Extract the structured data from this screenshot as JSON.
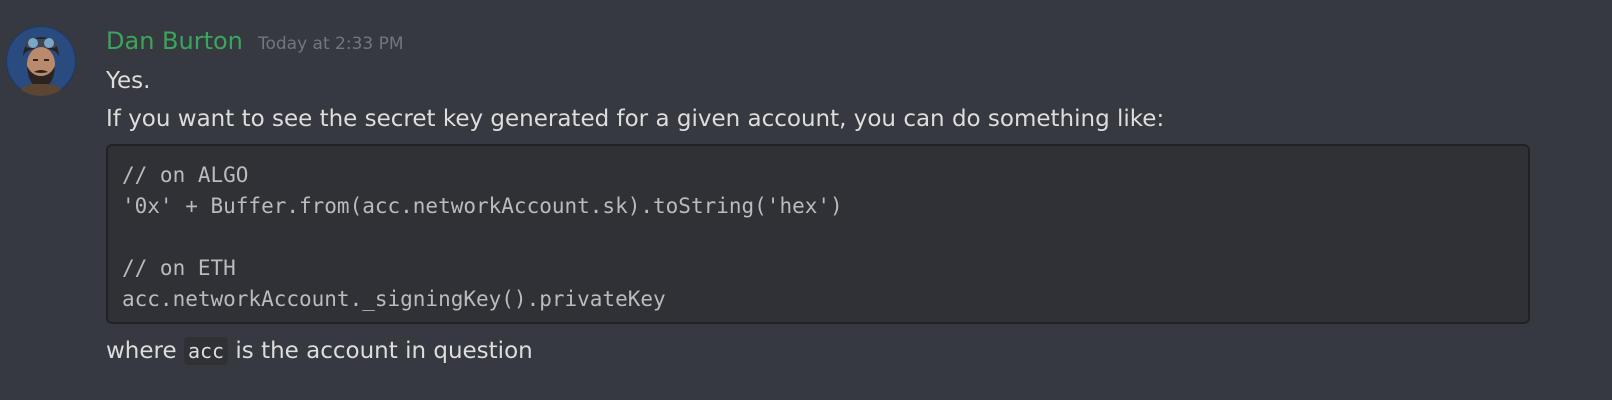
{
  "message": {
    "author": "Dan Burton",
    "timestamp": "Today at 2:33 PM",
    "author_color": "#3ba55c",
    "avatar_icon": "bearded-man-goggles-avatar",
    "lines": [
      "Yes.",
      "If you want to see the secret key generated for a given account, you can do something like:"
    ],
    "code_lines": [
      "// on ALGO",
      "'0x' + Buffer.from(acc.networkAccount.sk).toString('hex')",
      "",
      "// on ETH",
      "acc.networkAccount._signingKey().privateKey"
    ],
    "footer": {
      "before": "where ",
      "code": "acc",
      "after": " is the account in question"
    }
  }
}
